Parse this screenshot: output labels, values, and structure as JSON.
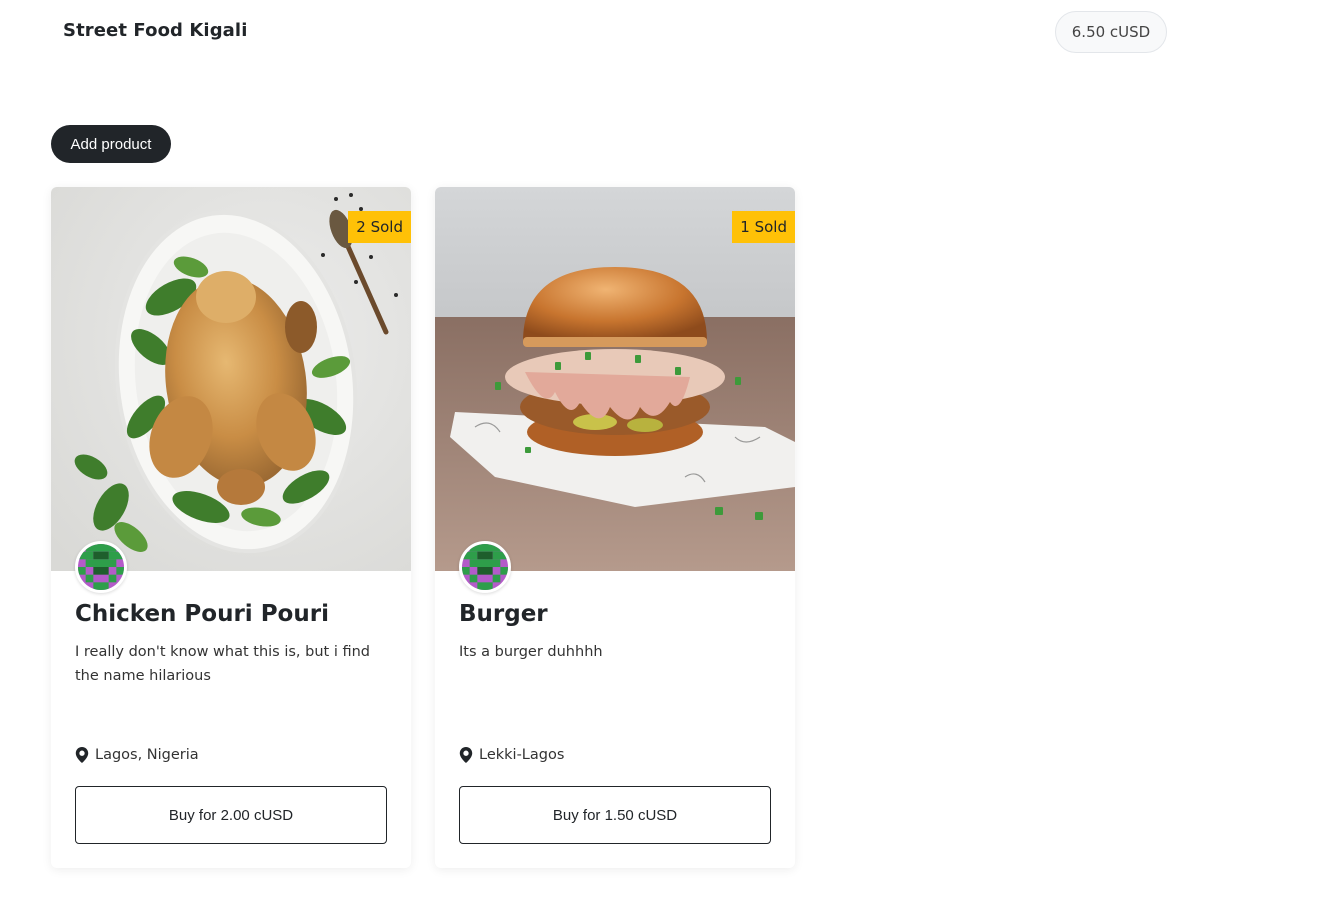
{
  "header": {
    "brand": "Street Food Kigali",
    "balance": "6.50 cUSD"
  },
  "actions": {
    "add_product_label": "Add product"
  },
  "products": [
    {
      "title": "Chicken Pouri Pouri",
      "description": "I really don't know what this is, but i find the name hilarious",
      "sold": "2 Sold",
      "location": "Lagos, Nigeria",
      "buy_label": "Buy for 2.00 cUSD"
    },
    {
      "title": "Burger",
      "description": "Its a burger duhhhh",
      "sold": "1 Sold",
      "location": "Lekki-Lagos",
      "buy_label": "Buy for 1.50 cUSD"
    }
  ],
  "colors": {
    "badge": "#ffc107",
    "dark": "#212529",
    "avatar_green": "#2e9e4a",
    "avatar_purple": "#b45bc9"
  },
  "icons": {
    "location": "map-pin-icon"
  }
}
